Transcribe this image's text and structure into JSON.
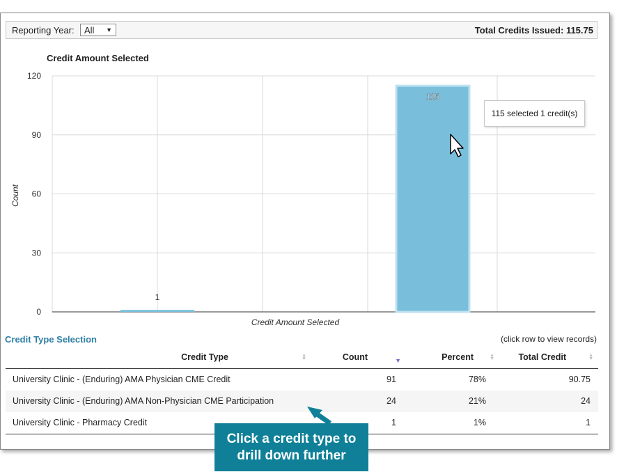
{
  "filter": {
    "label": "Reporting Year:",
    "selected": "All"
  },
  "total_credits": "Total Credits Issued: 115.75",
  "chart_data": {
    "type": "bar",
    "title": "Credit Amount Selected",
    "xlabel": "Credit Amount Selected",
    "ylabel": "Count",
    "ylim": [
      0,
      120
    ],
    "yticks": [
      "0",
      "30",
      "60",
      "90",
      "120"
    ],
    "values": [
      1,
      115
    ],
    "data_labels": [
      "1",
      "115"
    ],
    "grid": true,
    "bar_color": "#79bfdc",
    "highlight_stroke": "#bfe1ee"
  },
  "tooltip": "115 selected 1 credit(s)",
  "table": {
    "title": "Credit Type Selection",
    "hint": "(click row to view records)",
    "columns": [
      "Credit Type",
      "Count",
      "Percent",
      "Total Credit"
    ],
    "rows": [
      [
        "University Clinic - (Enduring) AMA Physician CME Credit",
        "91",
        "78%",
        "90.75"
      ],
      [
        "University Clinic - (Enduring) AMA Non-Physician CME Participation",
        "24",
        "21%",
        "24"
      ],
      [
        "University Clinic - Pharmacy Credit",
        "1",
        "1%",
        "1"
      ]
    ]
  },
  "callout": {
    "line1": "Click a credit type to",
    "line2": "drill down further",
    "color": "#0f8098"
  }
}
